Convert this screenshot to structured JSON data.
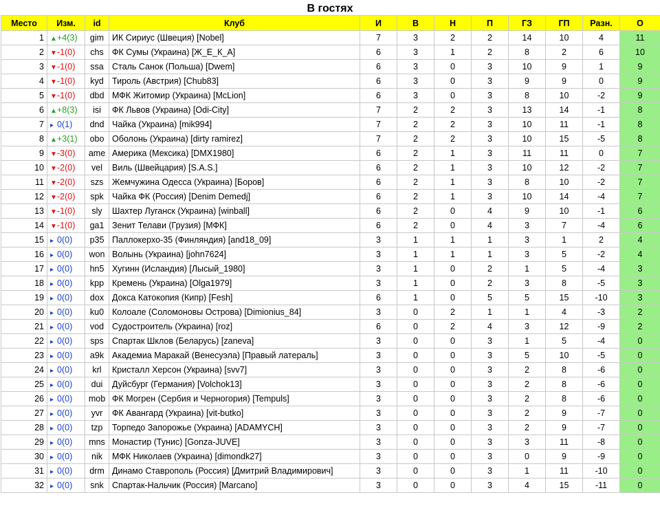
{
  "title": "В гостях",
  "icons": {
    "up": "triangle-up-icon",
    "down": "triangle-down-icon",
    "same": "triangle-right-icon"
  },
  "colors": {
    "header": "#ffff00",
    "points": "#99ee88",
    "up": "#22a022",
    "down": "#e01010",
    "same": "#1a3fcc"
  },
  "columns": [
    "Место",
    "Изм.",
    "id",
    "Клуб",
    "И",
    "В",
    "Н",
    "П",
    "ГЗ",
    "ГП",
    "Разн.",
    "О"
  ],
  "rows": [
    {
      "place": "1",
      "dir": "up",
      "chg": "+4(3)",
      "id": "gim",
      "club": "ИК Сириус (Швеция) [Nobel]",
      "i": "7",
      "w": "3",
      "d": "2",
      "l": "2",
      "gf": "14",
      "ga": "10",
      "diff": "4",
      "pts": "11"
    },
    {
      "place": "2",
      "dir": "down",
      "chg": "-1(0)",
      "id": "chs",
      "club": "ФК Сумы (Украина) [Ж_Е_К_А]",
      "i": "6",
      "w": "3",
      "d": "1",
      "l": "2",
      "gf": "8",
      "ga": "2",
      "diff": "6",
      "pts": "10"
    },
    {
      "place": "3",
      "dir": "down",
      "chg": "-1(0)",
      "id": "ssa",
      "club": "Сталь Санок (Польша) [Dwem]",
      "i": "6",
      "w": "3",
      "d": "0",
      "l": "3",
      "gf": "10",
      "ga": "9",
      "diff": "1",
      "pts": "9"
    },
    {
      "place": "4",
      "dir": "down",
      "chg": "-1(0)",
      "id": "kyd",
      "club": "Тироль (Австрия) [Chub83]",
      "i": "6",
      "w": "3",
      "d": "0",
      "l": "3",
      "gf": "9",
      "ga": "9",
      "diff": "0",
      "pts": "9"
    },
    {
      "place": "5",
      "dir": "down",
      "chg": "-1(0)",
      "id": "dbd",
      "club": "МФК Житомир (Украина) [McLion]",
      "i": "6",
      "w": "3",
      "d": "0",
      "l": "3",
      "gf": "8",
      "ga": "10",
      "diff": "-2",
      "pts": "9"
    },
    {
      "place": "6",
      "dir": "up",
      "chg": "+8(3)",
      "id": "isi",
      "club": "ФК Львов (Украина) [Odi-City]",
      "i": "7",
      "w": "2",
      "d": "2",
      "l": "3",
      "gf": "13",
      "ga": "14",
      "diff": "-1",
      "pts": "8"
    },
    {
      "place": "7",
      "dir": "same",
      "chg": "0(1)",
      "id": "dnd",
      "club": "Чайка (Украина) [mik994]",
      "i": "7",
      "w": "2",
      "d": "2",
      "l": "3",
      "gf": "10",
      "ga": "11",
      "diff": "-1",
      "pts": "8"
    },
    {
      "place": "8",
      "dir": "up",
      "chg": "+3(1)",
      "id": "obo",
      "club": "Оболонь (Украина) [dirty ramirez]",
      "i": "7",
      "w": "2",
      "d": "2",
      "l": "3",
      "gf": "10",
      "ga": "15",
      "diff": "-5",
      "pts": "8"
    },
    {
      "place": "9",
      "dir": "down",
      "chg": "-3(0)",
      "id": "ame",
      "club": "Америка (Мексика) [DMX1980]",
      "i": "6",
      "w": "2",
      "d": "1",
      "l": "3",
      "gf": "11",
      "ga": "11",
      "diff": "0",
      "pts": "7"
    },
    {
      "place": "10",
      "dir": "down",
      "chg": "-2(0)",
      "id": "vel",
      "club": "Виль (Швейцария) [S.A.S.]",
      "i": "6",
      "w": "2",
      "d": "1",
      "l": "3",
      "gf": "10",
      "ga": "12",
      "diff": "-2",
      "pts": "7"
    },
    {
      "place": "11",
      "dir": "down",
      "chg": "-2(0)",
      "id": "szs",
      "club": "Жемчужина Одесса (Украина) [Боров]",
      "i": "6",
      "w": "2",
      "d": "1",
      "l": "3",
      "gf": "8",
      "ga": "10",
      "diff": "-2",
      "pts": "7"
    },
    {
      "place": "12",
      "dir": "down",
      "chg": "-2(0)",
      "id": "spk",
      "club": "Чайка ФК (Россия) [Denim Demedj]",
      "i": "6",
      "w": "2",
      "d": "1",
      "l": "3",
      "gf": "10",
      "ga": "14",
      "diff": "-4",
      "pts": "7"
    },
    {
      "place": "13",
      "dir": "down",
      "chg": "-1(0)",
      "id": "sly",
      "club": "Шахтер Луганск (Украина) [winball]",
      "i": "6",
      "w": "2",
      "d": "0",
      "l": "4",
      "gf": "9",
      "ga": "10",
      "diff": "-1",
      "pts": "6"
    },
    {
      "place": "14",
      "dir": "down",
      "chg": "-1(0)",
      "id": "ga1",
      "club": "Зенит Телави (Грузия) [МФК]",
      "i": "6",
      "w": "2",
      "d": "0",
      "l": "4",
      "gf": "3",
      "ga": "7",
      "diff": "-4",
      "pts": "6"
    },
    {
      "place": "15",
      "dir": "same",
      "chg": "0(0)",
      "id": "p35",
      "club": "Паллокерхо-35 (Финляндия) [and18_09]",
      "i": "3",
      "w": "1",
      "d": "1",
      "l": "1",
      "gf": "3",
      "ga": "1",
      "diff": "2",
      "pts": "4"
    },
    {
      "place": "16",
      "dir": "same",
      "chg": "0(0)",
      "id": "won",
      "club": "Волынь (Украина) [john7624]",
      "i": "3",
      "w": "1",
      "d": "1",
      "l": "1",
      "gf": "3",
      "ga": "5",
      "diff": "-2",
      "pts": "4"
    },
    {
      "place": "17",
      "dir": "same",
      "chg": "0(0)",
      "id": "hn5",
      "club": "Хугинн (Исландия) [Лысый_1980]",
      "i": "3",
      "w": "1",
      "d": "0",
      "l": "2",
      "gf": "1",
      "ga": "5",
      "diff": "-4",
      "pts": "3"
    },
    {
      "place": "18",
      "dir": "same",
      "chg": "0(0)",
      "id": "kpp",
      "club": "Кремень (Украина) [Olga1979]",
      "i": "3",
      "w": "1",
      "d": "0",
      "l": "2",
      "gf": "3",
      "ga": "8",
      "diff": "-5",
      "pts": "3"
    },
    {
      "place": "19",
      "dir": "same",
      "chg": "0(0)",
      "id": "dox",
      "club": "Докса Катокопия (Кипр) [Fesh]",
      "i": "6",
      "w": "1",
      "d": "0",
      "l": "5",
      "gf": "5",
      "ga": "15",
      "diff": "-10",
      "pts": "3"
    },
    {
      "place": "20",
      "dir": "same",
      "chg": "0(0)",
      "id": "ku0",
      "club": "Колоале (Соломоновы Острова) [Dimionius_84]",
      "i": "3",
      "w": "0",
      "d": "2",
      "l": "1",
      "gf": "1",
      "ga": "4",
      "diff": "-3",
      "pts": "2"
    },
    {
      "place": "21",
      "dir": "same",
      "chg": "0(0)",
      "id": "vod",
      "club": "Судостроитель (Украина) [roz]",
      "i": "6",
      "w": "0",
      "d": "2",
      "l": "4",
      "gf": "3",
      "ga": "12",
      "diff": "-9",
      "pts": "2"
    },
    {
      "place": "22",
      "dir": "same",
      "chg": "0(0)",
      "id": "sps",
      "club": "Спартак Шклов (Беларусь) [zaneva]",
      "i": "3",
      "w": "0",
      "d": "0",
      "l": "3",
      "gf": "1",
      "ga": "5",
      "diff": "-4",
      "pts": "0"
    },
    {
      "place": "23",
      "dir": "same",
      "chg": "0(0)",
      "id": "a9k",
      "club": "Академиа Маракай (Венесуэла) [Правый латераль]",
      "i": "3",
      "w": "0",
      "d": "0",
      "l": "3",
      "gf": "5",
      "ga": "10",
      "diff": "-5",
      "pts": "0"
    },
    {
      "place": "24",
      "dir": "same",
      "chg": "0(0)",
      "id": "krl",
      "club": "Кристалл Херсон (Украина) [svv7]",
      "i": "3",
      "w": "0",
      "d": "0",
      "l": "3",
      "gf": "2",
      "ga": "8",
      "diff": "-6",
      "pts": "0"
    },
    {
      "place": "25",
      "dir": "same",
      "chg": "0(0)",
      "id": "dui",
      "club": "Дуйсбург (Германия) [Volchok13]",
      "i": "3",
      "w": "0",
      "d": "0",
      "l": "3",
      "gf": "2",
      "ga": "8",
      "diff": "-6",
      "pts": "0"
    },
    {
      "place": "26",
      "dir": "same",
      "chg": "0(0)",
      "id": "mob",
      "club": "ФК Могрен (Сербия и Черногория) [Tempuls]",
      "i": "3",
      "w": "0",
      "d": "0",
      "l": "3",
      "gf": "2",
      "ga": "8",
      "diff": "-6",
      "pts": "0"
    },
    {
      "place": "27",
      "dir": "same",
      "chg": "0(0)",
      "id": "yvr",
      "club": "ФК Авангард (Украина) [vit-butko]",
      "i": "3",
      "w": "0",
      "d": "0",
      "l": "3",
      "gf": "2",
      "ga": "9",
      "diff": "-7",
      "pts": "0"
    },
    {
      "place": "28",
      "dir": "same",
      "chg": "0(0)",
      "id": "tzp",
      "club": "Торпедо Запорожье (Украина) [ADAMYCH]",
      "i": "3",
      "w": "0",
      "d": "0",
      "l": "3",
      "gf": "2",
      "ga": "9",
      "diff": "-7",
      "pts": "0"
    },
    {
      "place": "29",
      "dir": "same",
      "chg": "0(0)",
      "id": "mns",
      "club": "Монастир (Тунис) [Gonza-JUVE]",
      "i": "3",
      "w": "0",
      "d": "0",
      "l": "3",
      "gf": "3",
      "ga": "11",
      "diff": "-8",
      "pts": "0"
    },
    {
      "place": "30",
      "dir": "same",
      "chg": "0(0)",
      "id": "nik",
      "club": "МФК Николаев (Украина) [dimondk27]",
      "i": "3",
      "w": "0",
      "d": "0",
      "l": "3",
      "gf": "0",
      "ga": "9",
      "diff": "-9",
      "pts": "0"
    },
    {
      "place": "31",
      "dir": "same",
      "chg": "0(0)",
      "id": "drm",
      "club": "Динамо Ставрополь (Россия) [Дмитрий Владимирович]",
      "i": "3",
      "w": "0",
      "d": "0",
      "l": "3",
      "gf": "1",
      "ga": "11",
      "diff": "-10",
      "pts": "0"
    },
    {
      "place": "32",
      "dir": "same",
      "chg": "0(0)",
      "id": "snk",
      "club": "Спартак-Нальчик (Россия) [Marcano]",
      "i": "3",
      "w": "0",
      "d": "0",
      "l": "3",
      "gf": "4",
      "ga": "15",
      "diff": "-11",
      "pts": "0"
    }
  ]
}
